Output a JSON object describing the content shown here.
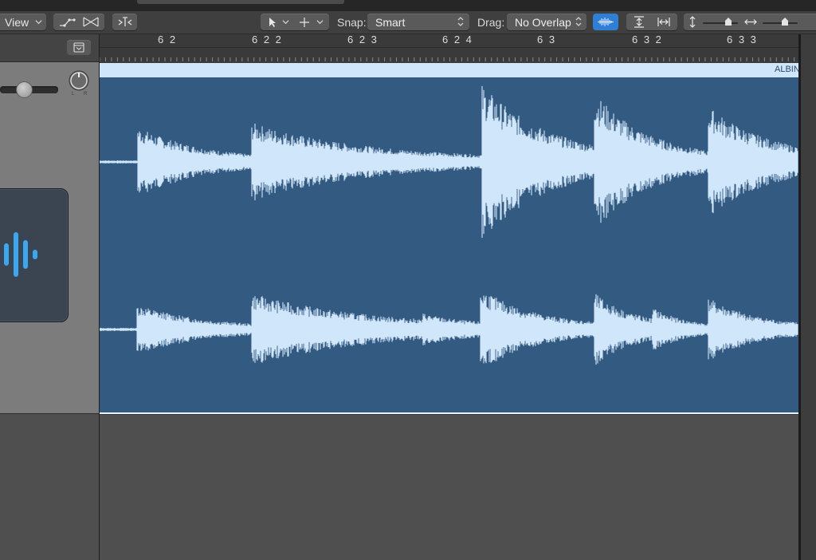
{
  "toolbar": {
    "view_label": "View",
    "snap_label": "Snap:",
    "snap_value": "Smart",
    "drag_label": "Drag:",
    "drag_value": "No Overlap"
  },
  "ruler": {
    "bar_labels": [
      "6 2",
      "6 2 2",
      "6 2 3",
      "6 2 4",
      "6 3",
      "6 3 2",
      "6 3 3"
    ]
  },
  "region": {
    "name": "ALBIN"
  },
  "colors": {
    "region_fill": "#335a80",
    "region_header": "#cfe6fb",
    "waveform": "#cfe6fb",
    "accent_blue": "#2f7fd6",
    "toolbar_bg": "#3f3f3f"
  },
  "icons": [
    "chevron-down-icon",
    "automation-icon",
    "flex-icon",
    "catch-playhead-icon",
    "pointer-tool-icon",
    "marquee-tool-icon",
    "waveform-zoom-icon",
    "vertical-zoom-icon",
    "horizontal-zoom-icon",
    "show-inspector-icon",
    "pan-knob-icon",
    "audio-track-icon"
  ]
}
